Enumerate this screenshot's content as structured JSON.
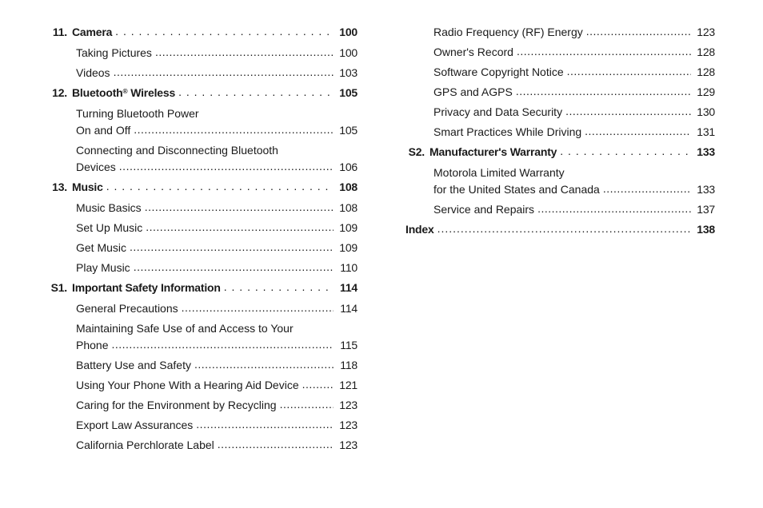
{
  "leaders": ". . . . . . . . . . . . . . . . . . . . . . . . . . . . . . . . . . . . . . . . . . . . . . . . . . . . . . . . . . . . . . . .",
  "sub_leaders": "...............................................................................",
  "col1": [
    {
      "kind": "chapter",
      "num": "11.",
      "title": "Camera",
      "page": "100"
    },
    {
      "kind": "sub",
      "title": "Taking Pictures",
      "page": "100"
    },
    {
      "kind": "sub",
      "title": "Videos",
      "page": "103"
    },
    {
      "kind": "chapter",
      "num": "12.",
      "title_html": "Bluetooth® Wireless",
      "title": "Bluetooth",
      "sup": "®",
      "title_after": " Wireless",
      "page": "105"
    },
    {
      "kind": "sub-multi",
      "line1": "Turning Bluetooth Power",
      "line2": "On and Off",
      "page": "105"
    },
    {
      "kind": "sub-multi",
      "line1": "Connecting and Disconnecting Bluetooth",
      "line2": "Devices",
      "page": "106"
    },
    {
      "kind": "chapter",
      "num": "13.",
      "title": "Music",
      "page": "108"
    },
    {
      "kind": "sub",
      "title": "Music Basics",
      "page": "108"
    },
    {
      "kind": "sub",
      "title": "Set Up Music",
      "page": "109"
    },
    {
      "kind": "sub",
      "title": "Get Music",
      "page": "109"
    },
    {
      "kind": "sub",
      "title": "Play Music",
      "page": "110"
    },
    {
      "kind": "chapter",
      "num": "S1.",
      "title": "Important Safety Information",
      "page": "114"
    },
    {
      "kind": "sub",
      "title": "General Precautions",
      "page": "114"
    },
    {
      "kind": "sub-multi",
      "line1": "Maintaining Safe Use of and Access to Your",
      "line2": "Phone",
      "page": "115"
    },
    {
      "kind": "sub",
      "title": "Battery Use and Safety",
      "page": "118"
    },
    {
      "kind": "sub",
      "title": "Using Your Phone With a Hearing Aid Device",
      "page": "121"
    },
    {
      "kind": "sub",
      "title": "Caring for the Environment by Recycling",
      "page": "123"
    },
    {
      "kind": "sub",
      "title": "Export Law Assurances",
      "page": "123"
    },
    {
      "kind": "sub",
      "title": "California Perchlorate Label",
      "page": "123"
    }
  ],
  "col2": [
    {
      "kind": "sub",
      "title": "Radio Frequency (RF) Energy",
      "page": "123"
    },
    {
      "kind": "sub",
      "title": "Owner's Record",
      "page": "128"
    },
    {
      "kind": "sub",
      "title": "Software Copyright Notice",
      "page": "128"
    },
    {
      "kind": "sub",
      "title": "GPS and AGPS",
      "page": "129"
    },
    {
      "kind": "sub",
      "title": "Privacy and Data Security",
      "page": "130"
    },
    {
      "kind": "sub",
      "title": "Smart Practices While Driving",
      "page": "131"
    },
    {
      "kind": "chapter",
      "num": "S2.",
      "title": "Manufacturer's Warranty",
      "page": "133"
    },
    {
      "kind": "sub-multi",
      "line1": "Motorola Limited Warranty",
      "line2": "for the United States and Canada",
      "page": "133"
    },
    {
      "kind": "sub",
      "title": "Service and Repairs",
      "page": "137"
    },
    {
      "kind": "index",
      "title": "Index",
      "page": "138"
    }
  ]
}
